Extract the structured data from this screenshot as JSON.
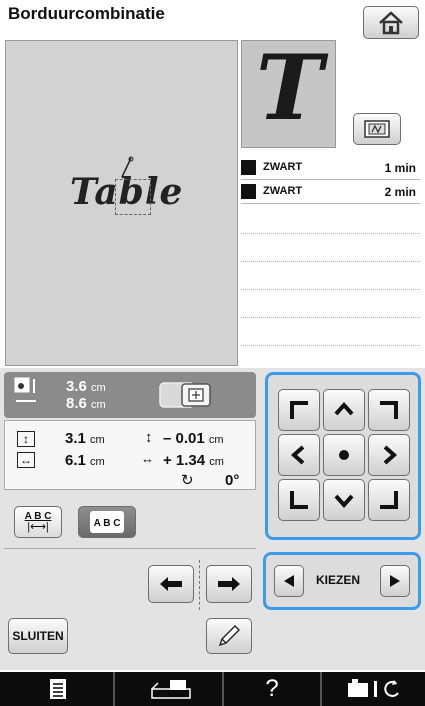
{
  "screen": {
    "title": "Borduurcombinatie"
  },
  "canvas": {
    "text": "Table"
  },
  "preview": {
    "letter": "T"
  },
  "colors": [
    {
      "name": "ZWART",
      "time": "1 min"
    },
    {
      "name": "ZWART",
      "time": "2 min"
    }
  ],
  "size": {
    "height_value": "3.6",
    "height_unit": "cm",
    "width_value": "8.6",
    "width_unit": "cm"
  },
  "position": {
    "height_value": "3.1",
    "height_unit": "cm",
    "width_value": "6.1",
    "width_unit": "cm",
    "vertical_offset": "– 0.01",
    "vertical_unit": "cm",
    "horizontal_offset": "+ 1.34",
    "horizontal_unit": "cm",
    "rotation": "0°"
  },
  "buttons": {
    "spacing_label": "A B C",
    "spacing2_label": "A B C",
    "kiezen": "KIEZEN",
    "sluiten": "SLUITEN"
  },
  "icons": {
    "home": "home-icon",
    "frame": "embroidery-frame-icon",
    "pencil": "pencil-icon",
    "arrow_left": "arrow-left-icon",
    "arrow_right": "arrow-right-icon",
    "list": "list-icon",
    "machine": "sewing-machine-icon",
    "help": "question-icon"
  },
  "accent": "#3c9be8"
}
